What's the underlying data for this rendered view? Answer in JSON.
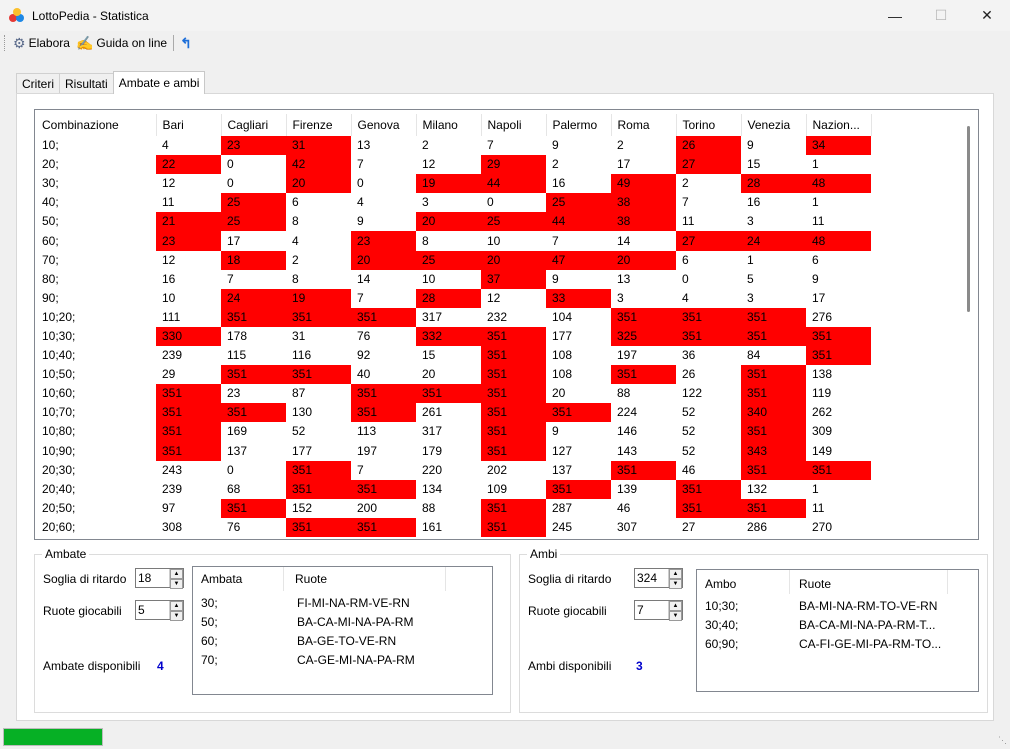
{
  "window": {
    "title": "LottoPedia - Statistica",
    "minimize_icon": "minimize-icon",
    "maximize_icon": "maximize-icon",
    "close_icon": "close-icon"
  },
  "toolbar": {
    "elabora_label": "Elabora",
    "guida_label": "Guida on line"
  },
  "tabs": [
    {
      "label": "Criteri",
      "active": false
    },
    {
      "label": "Risultati",
      "active": false
    },
    {
      "label": "Ambate e ambi",
      "active": true
    }
  ],
  "grid": {
    "columns": [
      "Combinazione",
      "Bari",
      "Cagliari",
      "Firenze",
      "Genova",
      "Milano",
      "Napoli",
      "Palermo",
      "Roma",
      "Torino",
      "Venezia",
      "Nazion..."
    ],
    "rows": [
      {
        "label": "10;",
        "values": [
          "4",
          "23",
          "31",
          "13",
          "2",
          "7",
          "9",
          "2",
          "26",
          "9",
          "34"
        ],
        "highlight": [
          0,
          1,
          1,
          0,
          0,
          0,
          0,
          0,
          1,
          0,
          1
        ]
      },
      {
        "label": "20;",
        "values": [
          "22",
          "0",
          "42",
          "7",
          "12",
          "29",
          "2",
          "17",
          "27",
          "15",
          "1"
        ],
        "highlight": [
          1,
          0,
          1,
          0,
          0,
          1,
          0,
          0,
          1,
          0,
          0
        ]
      },
      {
        "label": "30;",
        "values": [
          "12",
          "0",
          "20",
          "0",
          "19",
          "44",
          "16",
          "49",
          "2",
          "28",
          "48"
        ],
        "highlight": [
          0,
          0,
          1,
          0,
          1,
          1,
          0,
          1,
          0,
          1,
          1
        ]
      },
      {
        "label": "40;",
        "values": [
          "11",
          "25",
          "6",
          "4",
          "3",
          "0",
          "25",
          "38",
          "7",
          "16",
          "1"
        ],
        "highlight": [
          0,
          1,
          0,
          0,
          0,
          0,
          1,
          1,
          0,
          0,
          0
        ]
      },
      {
        "label": "50;",
        "values": [
          "21",
          "25",
          "8",
          "9",
          "20",
          "25",
          "44",
          "38",
          "11",
          "3",
          "11"
        ],
        "highlight": [
          1,
          1,
          0,
          0,
          1,
          1,
          1,
          1,
          0,
          0,
          0
        ]
      },
      {
        "label": "60;",
        "values": [
          "23",
          "17",
          "4",
          "23",
          "8",
          "10",
          "7",
          "14",
          "27",
          "24",
          "48"
        ],
        "highlight": [
          1,
          0,
          0,
          1,
          0,
          0,
          0,
          0,
          1,
          1,
          1
        ]
      },
      {
        "label": "70;",
        "values": [
          "12",
          "18",
          "2",
          "20",
          "25",
          "20",
          "47",
          "20",
          "6",
          "1",
          "6"
        ],
        "highlight": [
          0,
          1,
          0,
          1,
          1,
          1,
          1,
          1,
          0,
          0,
          0
        ]
      },
      {
        "label": "80;",
        "values": [
          "16",
          "7",
          "8",
          "14",
          "10",
          "37",
          "9",
          "13",
          "0",
          "5",
          "9"
        ],
        "highlight": [
          0,
          0,
          0,
          0,
          0,
          1,
          0,
          0,
          0,
          0,
          0
        ]
      },
      {
        "label": "90;",
        "values": [
          "10",
          "24",
          "19",
          "7",
          "28",
          "12",
          "33",
          "3",
          "4",
          "3",
          "17"
        ],
        "highlight": [
          0,
          1,
          1,
          0,
          1,
          0,
          1,
          0,
          0,
          0,
          0
        ]
      },
      {
        "label": "10;20;",
        "values": [
          "111",
          "351",
          "351",
          "351",
          "317",
          "232",
          "104",
          "351",
          "351",
          "351",
          "276"
        ],
        "highlight": [
          0,
          1,
          1,
          1,
          0,
          0,
          0,
          1,
          1,
          1,
          0
        ]
      },
      {
        "label": "10;30;",
        "values": [
          "330",
          "178",
          "31",
          "76",
          "332",
          "351",
          "177",
          "325",
          "351",
          "351",
          "351"
        ],
        "highlight": [
          1,
          0,
          0,
          0,
          1,
          1,
          0,
          1,
          1,
          1,
          1
        ]
      },
      {
        "label": "10;40;",
        "values": [
          "239",
          "115",
          "116",
          "92",
          "15",
          "351",
          "108",
          "197",
          "36",
          "84",
          "351"
        ],
        "highlight": [
          0,
          0,
          0,
          0,
          0,
          1,
          0,
          0,
          0,
          0,
          1
        ]
      },
      {
        "label": "10;50;",
        "values": [
          "29",
          "351",
          "351",
          "40",
          "20",
          "351",
          "108",
          "351",
          "26",
          "351",
          "138"
        ],
        "highlight": [
          0,
          1,
          1,
          0,
          0,
          1,
          0,
          1,
          0,
          1,
          0
        ]
      },
      {
        "label": "10;60;",
        "values": [
          "351",
          "23",
          "87",
          "351",
          "351",
          "351",
          "20",
          "88",
          "122",
          "351",
          "119"
        ],
        "highlight": [
          1,
          0,
          0,
          1,
          1,
          1,
          0,
          0,
          0,
          1,
          0
        ]
      },
      {
        "label": "10;70;",
        "values": [
          "351",
          "351",
          "130",
          "351",
          "261",
          "351",
          "351",
          "224",
          "52",
          "340",
          "262"
        ],
        "highlight": [
          1,
          1,
          0,
          1,
          0,
          1,
          1,
          0,
          0,
          1,
          0
        ]
      },
      {
        "label": "10;80;",
        "values": [
          "351",
          "169",
          "52",
          "113",
          "317",
          "351",
          "9",
          "146",
          "52",
          "351",
          "309"
        ],
        "highlight": [
          1,
          0,
          0,
          0,
          0,
          1,
          0,
          0,
          0,
          1,
          0
        ]
      },
      {
        "label": "10;90;",
        "values": [
          "351",
          "137",
          "177",
          "197",
          "179",
          "351",
          "127",
          "143",
          "52",
          "343",
          "149"
        ],
        "highlight": [
          1,
          0,
          0,
          0,
          0,
          1,
          0,
          0,
          0,
          1,
          0
        ]
      },
      {
        "label": "20;30;",
        "values": [
          "243",
          "0",
          "351",
          "7",
          "220",
          "202",
          "137",
          "351",
          "46",
          "351",
          "351"
        ],
        "highlight": [
          0,
          0,
          1,
          0,
          0,
          0,
          0,
          1,
          0,
          1,
          1
        ]
      },
      {
        "label": "20;40;",
        "values": [
          "239",
          "68",
          "351",
          "351",
          "134",
          "109",
          "351",
          "139",
          "351",
          "132",
          "1"
        ],
        "highlight": [
          0,
          0,
          1,
          1,
          0,
          0,
          1,
          0,
          1,
          0,
          0
        ]
      },
      {
        "label": "20;50;",
        "values": [
          "97",
          "351",
          "152",
          "200",
          "88",
          "351",
          "287",
          "46",
          "351",
          "351",
          "11"
        ],
        "highlight": [
          0,
          1,
          0,
          0,
          0,
          1,
          0,
          0,
          1,
          1,
          0
        ]
      },
      {
        "label": "20;60;",
        "values": [
          "308",
          "76",
          "351",
          "351",
          "161",
          "351",
          "245",
          "307",
          "27",
          "286",
          "270"
        ],
        "highlight": [
          0,
          0,
          1,
          1,
          0,
          1,
          0,
          0,
          0,
          0,
          0
        ]
      }
    ]
  },
  "ambate": {
    "legend": "Ambate",
    "soglia_label": "Soglia di ritardo",
    "soglia_value": "18",
    "ruote_label": "Ruote giocabili",
    "ruote_value": "5",
    "disponibili_label": "Ambate disponibili",
    "disponibili_count": "4",
    "list_headers": [
      "Ambata",
      "Ruote"
    ],
    "list": [
      {
        "num": "30;",
        "ruote": "FI-MI-NA-RM-VE-RN"
      },
      {
        "num": "50;",
        "ruote": "BA-CA-MI-NA-PA-RM"
      },
      {
        "num": "60;",
        "ruote": "BA-GE-TO-VE-RN"
      },
      {
        "num": "70;",
        "ruote": "CA-GE-MI-NA-PA-RM"
      }
    ]
  },
  "ambi": {
    "legend": "Ambi",
    "soglia_label": "Soglia di ritardo",
    "soglia_value": "324",
    "ruote_label": "Ruote giocabili",
    "ruote_value": "7",
    "disponibili_label": "Ambi disponibili",
    "disponibili_count": "3",
    "list_headers": [
      "Ambo",
      "Ruote"
    ],
    "list": [
      {
        "num": "10;30;",
        "ruote": "BA-MI-NA-RM-TO-VE-RN"
      },
      {
        "num": "30;40;",
        "ruote": "BA-CA-MI-NA-PA-RM-T..."
      },
      {
        "num": "60;90;",
        "ruote": "CA-FI-GE-MI-PA-RM-TO..."
      }
    ]
  },
  "status": {
    "progress": 1.0,
    "progress_color": "#06b025"
  },
  "colors": {
    "highlight": "#ff0000",
    "count_blue": "#0000cc"
  }
}
